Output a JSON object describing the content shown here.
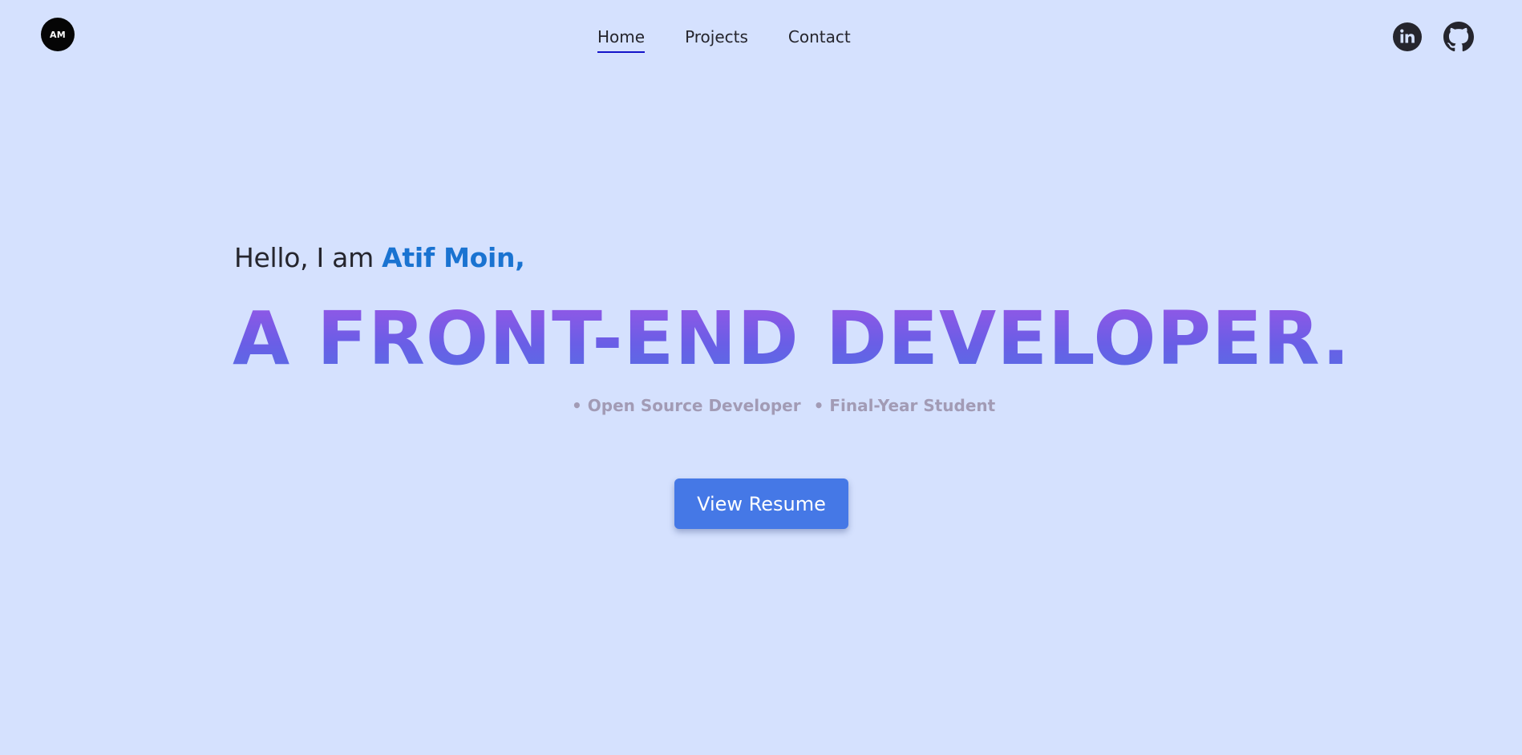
{
  "header": {
    "logo_text": "AM",
    "nav": {
      "home": "Home",
      "projects": "Projects",
      "contact": "Contact"
    },
    "social": {
      "linkedin_icon": "linkedin-icon",
      "github_icon": "github-icon"
    }
  },
  "hero": {
    "greeting": "Hello, I am ",
    "name": "Atif Moin,",
    "headline": "A FRONT-END DEVELOPER.",
    "roles": [
      "• Open Source Developer",
      "• Final-Year Student"
    ],
    "resume_button": "View Resume"
  },
  "colors": {
    "background": "#d5e1fe",
    "name_accent": "#1a73d1",
    "headline_gradient_top": "#9c56e6",
    "headline_gradient_bottom": "#5470e4",
    "button": "#4578e6",
    "active_underline": "#1313c9",
    "role_text": "#a29bb5"
  }
}
